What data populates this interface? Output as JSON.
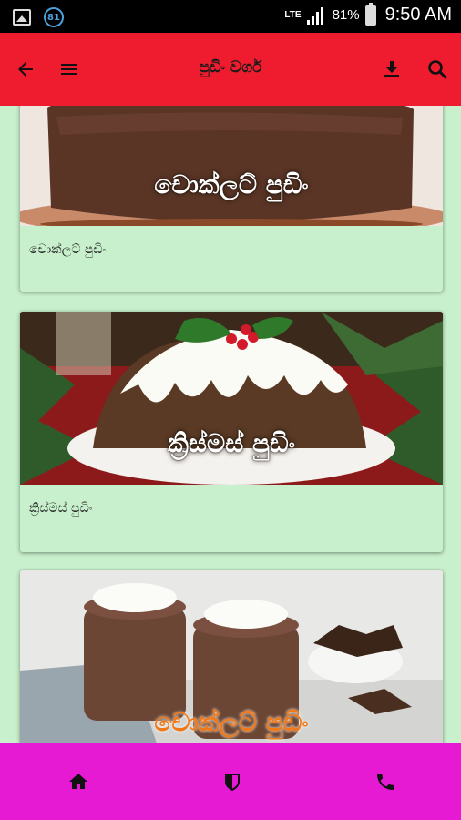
{
  "status_bar": {
    "notification_count": "81",
    "network": "LTE",
    "battery": "81%",
    "time": "9:50 AM"
  },
  "app_bar": {
    "title": "පුඩිං වර්ග",
    "icons": [
      "arrow-back-icon",
      "menu-icon",
      "download-icon",
      "search-icon"
    ]
  },
  "recipes": [
    {
      "title": "චොක්ලට් පුඩිං",
      "image_caption": "චොක්ලට් පුඩිං"
    },
    {
      "title": "ක්‍රිස්මස් පුඩිං",
      "image_caption": "ක්‍රිස්මස් පුඩිං"
    },
    {
      "title": "",
      "image_caption": "චොක්ලට් පුඩිං"
    }
  ],
  "bottom_nav": {
    "icons": [
      "home-icon",
      "shield-icon",
      "phone-icon"
    ]
  },
  "colors": {
    "app_bar": "#ee1c2e",
    "bottom_bar": "#e61ad2",
    "background": "#c8f0cc"
  }
}
